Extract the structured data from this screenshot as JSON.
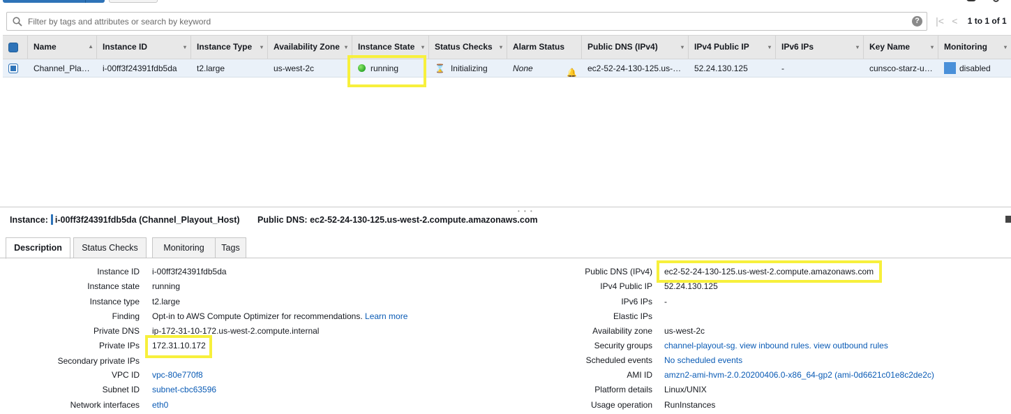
{
  "filter": {
    "placeholder": "Filter by tags and attributes or search by keyword",
    "help": "?",
    "pager_text": "1 to 1 of 1"
  },
  "grid": {
    "columns": [
      {
        "label": "Name",
        "sort": "▲"
      },
      {
        "label": "Instance ID",
        "sort": "▾"
      },
      {
        "label": "Instance Type",
        "sort": "▾"
      },
      {
        "label": "Availability Zone",
        "sort": "▾"
      },
      {
        "label": "Instance State",
        "sort": "▾"
      },
      {
        "label": "Status Checks",
        "sort": "▾"
      },
      {
        "label": "Alarm Status",
        "sort": ""
      },
      {
        "label": "Public DNS (IPv4)",
        "sort": "▾"
      },
      {
        "label": "IPv4 Public IP",
        "sort": "▾"
      },
      {
        "label": "IPv6 IPs",
        "sort": "▾"
      },
      {
        "label": "Key Name",
        "sort": "▾"
      },
      {
        "label": "Monitoring",
        "sort": "▾"
      }
    ],
    "row": {
      "name": "Channel_Pla…",
      "instance_id": "i-00ff3f24391fdb5da",
      "instance_type": "t2.large",
      "availability_zone": "us-west-2c",
      "instance_state": "running",
      "status_checks": "Initializing",
      "alarm_status": "None",
      "public_dns": "ec2-52-24-130-125.us-…",
      "ipv4_public_ip": "52.24.130.125",
      "ipv6_ips": "-",
      "key_name": "cunsco-starz-u…",
      "monitoring": "disabled"
    }
  },
  "instance_header": {
    "label": "Instance:",
    "value": "i-00ff3f24391fdb5da (Channel_Playout_Host)",
    "dns_label": "Public DNS:",
    "dns_value": "ec2-52-24-130-125.us-west-2.compute.amazonaws.com"
  },
  "tabs": [
    "Description",
    "Status Checks",
    "Monitoring",
    "Tags"
  ],
  "description_left": [
    {
      "label": "Instance ID",
      "value": "i-00ff3f24391fdb5da"
    },
    {
      "label": "Instance state",
      "value": "running"
    },
    {
      "label": "Instance type",
      "value": "t2.large"
    },
    {
      "label": "Finding",
      "value": "Opt-in to AWS Compute Optimizer for recommendations.",
      "link": "Learn more"
    },
    {
      "label": "Private DNS",
      "value": "ip-172-31-10-172.us-west-2.compute.internal"
    },
    {
      "label": "Private IPs",
      "value": "172.31.10.172"
    },
    {
      "label": "Secondary private IPs",
      "value": ""
    },
    {
      "label": "VPC ID",
      "link": "vpc-80e770f8"
    },
    {
      "label": "Subnet ID",
      "link": "subnet-cbc63596"
    },
    {
      "label": "Network interfaces",
      "link": "eth0"
    }
  ],
  "description_right": [
    {
      "label": "Public DNS (IPv4)",
      "value": "ec2-52-24-130-125.us-west-2.compute.amazonaws.com"
    },
    {
      "label": "IPv4 Public IP",
      "value": "52.24.130.125"
    },
    {
      "label": "IPv6 IPs",
      "value": "-"
    },
    {
      "label": "Elastic IPs",
      "value": ""
    },
    {
      "label": "Availability zone",
      "value": "us-west-2c"
    },
    {
      "label": "Security groups",
      "link": "channel-playout-sg. view inbound rules. view outbound rules"
    },
    {
      "label": "Scheduled events",
      "link": "No scheduled events"
    },
    {
      "label": "AMI ID",
      "link": "amzn2-ami-hvm-2.0.20200406.0-x86_64-gp2 (ami-0d6621c01e8c2de2c)"
    },
    {
      "label": "Platform details",
      "value": "Linux/UNIX"
    },
    {
      "label": "Usage operation",
      "value": "RunInstances"
    }
  ],
  "colors": {
    "accent": "#2e73b8",
    "link": "#0a5bb5",
    "highlight": "#f7f03c",
    "selected_row": "#eaf1f9"
  }
}
